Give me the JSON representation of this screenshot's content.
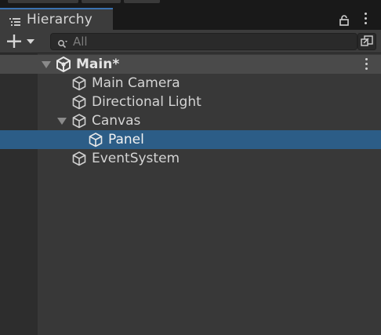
{
  "window": {
    "tab_label": "Hierarchy"
  },
  "toolbar": {
    "search_placeholder": "All"
  },
  "scene": {
    "name": "Main*"
  },
  "items": [
    {
      "label": "Main Camera",
      "depth": 1,
      "selected": false
    },
    {
      "label": "Directional Light",
      "depth": 1,
      "selected": false
    },
    {
      "label": "Canvas",
      "depth": 1,
      "selected": false,
      "expanded": true
    },
    {
      "label": "Panel",
      "depth": 2,
      "selected": true
    },
    {
      "label": "EventSystem",
      "depth": 1,
      "selected": false
    }
  ],
  "colors": {
    "background": "#383838",
    "selection": "#2c5d87",
    "tab_accent": "#3a72b0",
    "scene_row": "#4a4a4a"
  }
}
